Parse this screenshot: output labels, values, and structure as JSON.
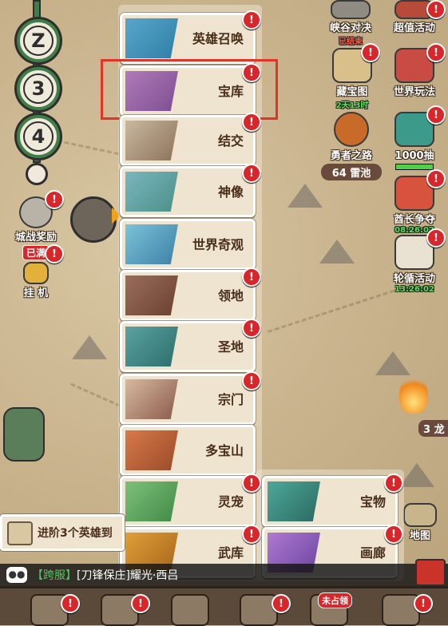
{
  "left_rail": {
    "nodes": [
      "Z",
      "3",
      "4"
    ],
    "city_battle_label": "城战奖励",
    "idle_full_badge": "已满",
    "idle_label": "挂 机"
  },
  "right_rail": {
    "canyon": {
      "label": "峡谷对决",
      "status": "已结束"
    },
    "super_event": {
      "label": "超值活动"
    },
    "treasure_map": {
      "label": "藏宝图",
      "timer": "2天13时"
    },
    "world_play": {
      "label": "世界玩法"
    },
    "brave_road": {
      "label": "勇者之路",
      "pool": "64 雷池"
    },
    "draw": {
      "label": "1000抽"
    },
    "chief": {
      "label": "酋长争夺",
      "timer": "08:26:02"
    },
    "rotation": {
      "label": "轮循活动",
      "timer": "13:26:02"
    },
    "dragon_count": "3 龙",
    "map_label": "地图"
  },
  "menu": {
    "items": [
      {
        "label": "英雄召唤"
      },
      {
        "label": "宝库"
      },
      {
        "label": "结交"
      },
      {
        "label": "神像"
      },
      {
        "label": "世界奇观"
      },
      {
        "label": "领地"
      },
      {
        "label": "圣地"
      },
      {
        "label": "宗门"
      },
      {
        "label": "多宝山"
      },
      {
        "label": "灵宠"
      },
      {
        "label": "武库"
      }
    ],
    "right_items": [
      {
        "label": "宝物"
      },
      {
        "label": "画廊"
      }
    ],
    "badge_text": "!"
  },
  "task": {
    "text": "进阶3个英雄到"
  },
  "chat": {
    "channel": "【跨服】",
    "text": "[刀锋保庄]耀光·西吕"
  },
  "dock": {
    "unclaimed_badge": "未占领"
  },
  "colors": {
    "badge": "#d8262a",
    "highlight": "#e23328",
    "card_bg": "#efe4cf"
  }
}
